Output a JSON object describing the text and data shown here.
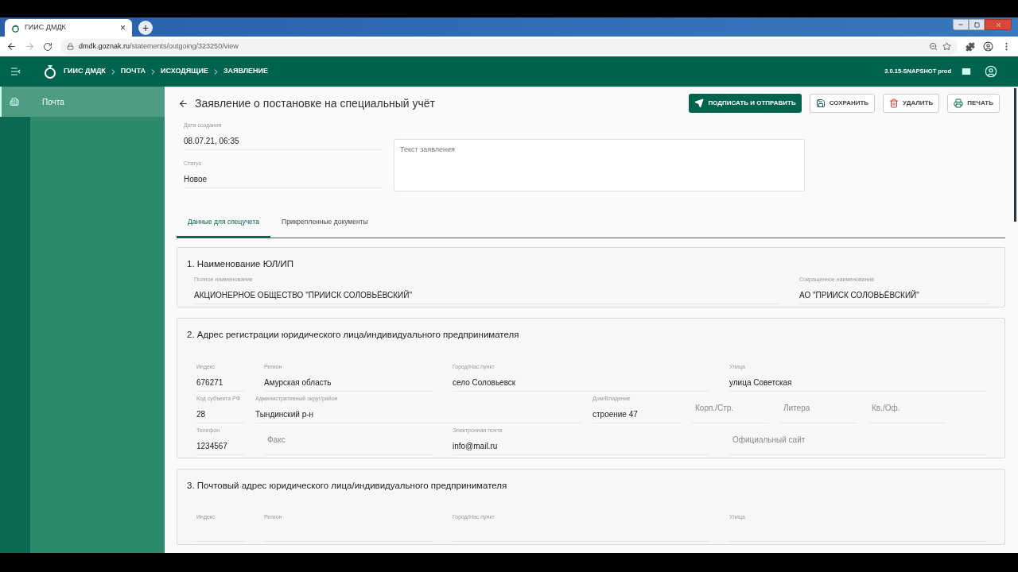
{
  "browser": {
    "tab_title": "ГИИС ДМДК",
    "new_tab": "+",
    "close": "×",
    "url_host": "dmdk.goznak.ru",
    "url_path": "/statements/outgoing/323250/view"
  },
  "header": {
    "breadcrumbs": [
      "ГИИС ДМДК",
      "ПОЧТА",
      "ИСХОДЯЩИЕ",
      "ЗАЯВЛЕНИЕ"
    ],
    "version": "3.0.15-SNAPSHOT prod"
  },
  "sidebar": {
    "items": [
      {
        "label": "Почта",
        "selected": true
      }
    ]
  },
  "page": {
    "title": "Заявление о постановке на специальный учёт",
    "buttons": [
      {
        "label": "ПОДПИСАТЬ И ОТПРАВИТЬ",
        "kind": "send"
      },
      {
        "label": "СОХРАНИТЬ",
        "kind": "save"
      },
      {
        "label": "УДАЛИТЬ",
        "kind": "delete"
      },
      {
        "label": "ПЕЧАТЬ",
        "kind": "print"
      }
    ],
    "meta": [
      {
        "label": "Дата создания",
        "value": "08.07.21, 06:35"
      },
      {
        "label": "Статус",
        "value": "Новое"
      }
    ],
    "text_field": {
      "placeholder": "Текст заявления"
    },
    "tabs": [
      {
        "label": "Данные для спецучета",
        "selected": true
      },
      {
        "label": "Прикрепленные документы",
        "selected": false
      }
    ],
    "sections": [
      {
        "title": "1. Наименование ЮЛ/ИП",
        "rows": [
          [
            {
              "label": "Полное наименование",
              "value": "АКЦИОНЕРНОЕ ОБЩЕСТВО \"ПРИИСК СОЛОВЬЁВСКИЙ\""
            },
            {
              "label": "Сокращенное наименование",
              "value": "АО \"ПРИИСК СОЛОВЬЁВСКИЙ\""
            }
          ]
        ]
      },
      {
        "title": "2. Адрес регистрации юридического лица/индивидуального предпринимателя",
        "rows": [
          [
            {
              "label": "Индекс",
              "value": "676271"
            },
            {
              "label": "Регион",
              "value": "Амурская область"
            },
            {
              "label": "Город/Нас.пункт",
              "value": "село Соловьевск"
            },
            {
              "label": "Улица",
              "value": "улица Советская"
            }
          ],
          [
            {
              "label": "Код субъекта РФ",
              "value": "28"
            },
            {
              "label": "Административный округ/район",
              "value": "Тындинский р-н"
            },
            {
              "label": "Дом/Владение",
              "value": "строение 47"
            },
            {
              "placeholder": "Корп./Стр."
            },
            {
              "placeholder": "Литера"
            },
            {
              "placeholder": "Кв./Оф."
            }
          ],
          [
            {
              "label": "Телефон",
              "value": "1234567"
            },
            {
              "placeholder": "Факс"
            },
            {
              "label": "Электронная почта",
              "value": "info@mail.ru"
            },
            {
              "placeholder": "Официальный сайт"
            }
          ]
        ]
      },
      {
        "title": "3. Почтовый адрес юридического лица/индивидуального предпринимателя",
        "rows": [
          [
            {
              "label": "Индекс"
            },
            {
              "label": "Регион"
            },
            {
              "label": "Город/Нас.пункт"
            },
            {
              "label": "Улица"
            }
          ]
        ]
      }
    ]
  }
}
